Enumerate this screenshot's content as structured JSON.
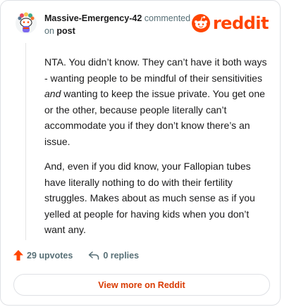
{
  "comment": {
    "username": "Massive-Emergency-42",
    "action_text": "commented",
    "on_text": "on",
    "post_link": "post",
    "paragraphs": [
      {
        "before": "NTA. You didn’t know. They can’t have it both ways - wanting people to be mindful of their sensitivities ",
        "emphasis": "and",
        "after": " wanting to keep the issue private. You get one or the other, because people literally can’t accommodate you if they don’t know there’s an issue."
      },
      {
        "text": "And, even if you did know, your Fallopian tubes have literally nothing to do with their fertility struggles. Makes about as much sense as if you yelled at people for having kids when you don’t want any."
      }
    ]
  },
  "brand": {
    "wordmark": "reddit",
    "color": "#ff4500"
  },
  "actions": {
    "upvotes_label": "29 upvotes",
    "replies_label": "0 replies",
    "upvote_icon": "upvote-arrow-icon",
    "reply_icon": "reply-arrow-icon"
  },
  "footer": {
    "view_more_label": "View more on Reddit"
  }
}
